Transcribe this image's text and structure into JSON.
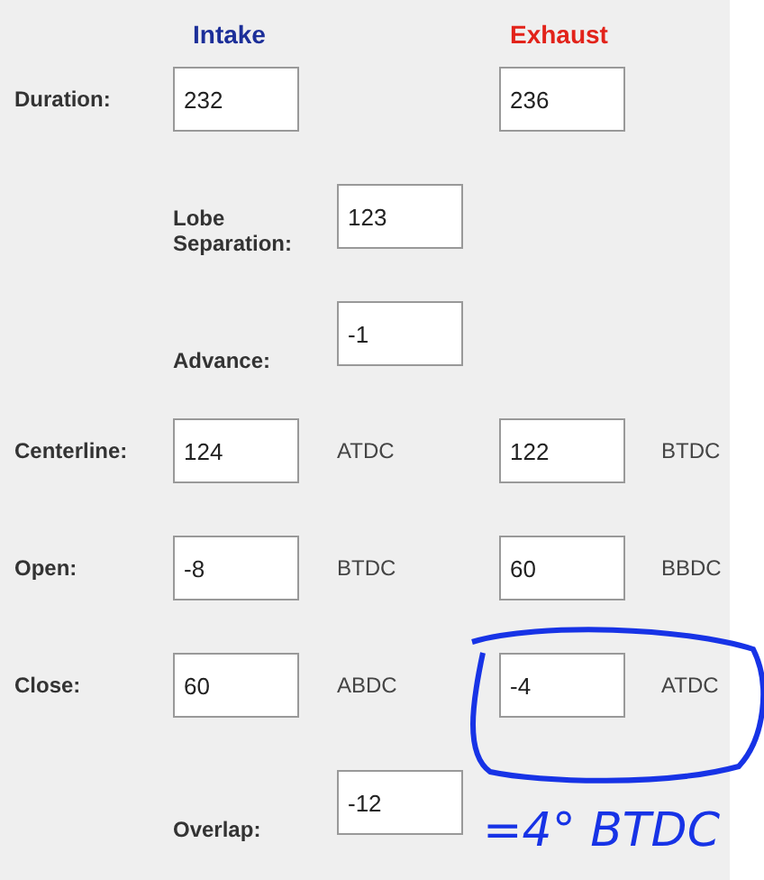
{
  "headers": {
    "intake": "Intake",
    "exhaust": "Exhaust"
  },
  "rows": [
    {
      "kind": "pair",
      "label": "Duration:",
      "intake": "232",
      "exhaust": "236"
    },
    {
      "kind": "single",
      "label": "Lobe Separation:",
      "value": "123"
    },
    {
      "kind": "single",
      "label": "Advance:",
      "value": "-1"
    },
    {
      "kind": "pair",
      "label": "Centerline:",
      "intake": "124",
      "intake_unit": "ATDC",
      "exhaust": "122",
      "exhaust_unit": "BTDC"
    },
    {
      "kind": "pair",
      "label": "Open:",
      "intake": "-8",
      "intake_unit": "BTDC",
      "exhaust": "60",
      "exhaust_unit": "BBDC"
    },
    {
      "kind": "pair",
      "label": "Close:",
      "intake": "60",
      "intake_unit": "ABDC",
      "exhaust": "-4",
      "exhaust_unit": "ATDC"
    },
    {
      "kind": "single",
      "label": "Overlap:",
      "value": "-12"
    }
  ],
  "annotation": {
    "text": "=4° BTDC"
  }
}
